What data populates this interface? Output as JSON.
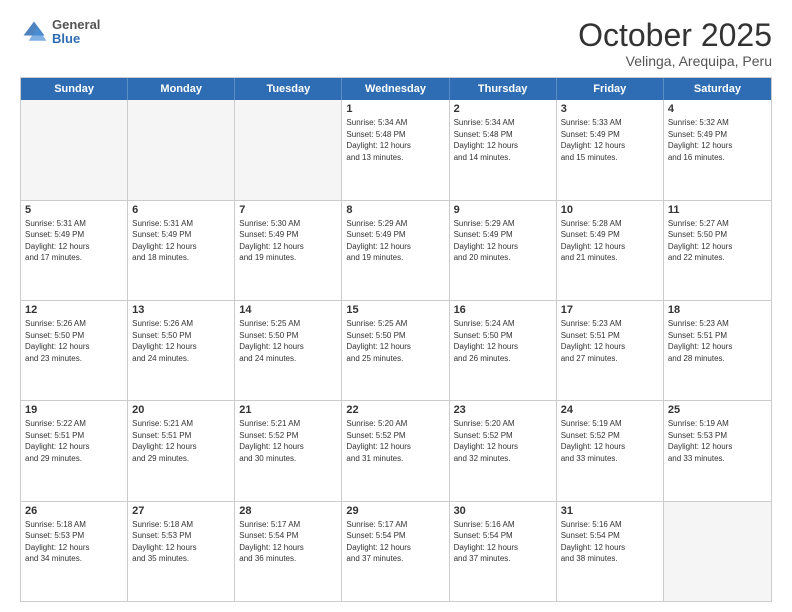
{
  "header": {
    "logo": {
      "general": "General",
      "blue": "Blue"
    },
    "title": "October 2025",
    "subtitle": "Velinga, Arequipa, Peru"
  },
  "days": [
    "Sunday",
    "Monday",
    "Tuesday",
    "Wednesday",
    "Thursday",
    "Friday",
    "Saturday"
  ],
  "weeks": [
    [
      {
        "day": "",
        "info": "",
        "empty": true
      },
      {
        "day": "",
        "info": "",
        "empty": true
      },
      {
        "day": "",
        "info": "",
        "empty": true
      },
      {
        "day": "1",
        "info": "Sunrise: 5:34 AM\nSunset: 5:48 PM\nDaylight: 12 hours\nand 13 minutes."
      },
      {
        "day": "2",
        "info": "Sunrise: 5:34 AM\nSunset: 5:48 PM\nDaylight: 12 hours\nand 14 minutes."
      },
      {
        "day": "3",
        "info": "Sunrise: 5:33 AM\nSunset: 5:49 PM\nDaylight: 12 hours\nand 15 minutes."
      },
      {
        "day": "4",
        "info": "Sunrise: 5:32 AM\nSunset: 5:49 PM\nDaylight: 12 hours\nand 16 minutes."
      }
    ],
    [
      {
        "day": "5",
        "info": "Sunrise: 5:31 AM\nSunset: 5:49 PM\nDaylight: 12 hours\nand 17 minutes."
      },
      {
        "day": "6",
        "info": "Sunrise: 5:31 AM\nSunset: 5:49 PM\nDaylight: 12 hours\nand 18 minutes."
      },
      {
        "day": "7",
        "info": "Sunrise: 5:30 AM\nSunset: 5:49 PM\nDaylight: 12 hours\nand 19 minutes."
      },
      {
        "day": "8",
        "info": "Sunrise: 5:29 AM\nSunset: 5:49 PM\nDaylight: 12 hours\nand 19 minutes."
      },
      {
        "day": "9",
        "info": "Sunrise: 5:29 AM\nSunset: 5:49 PM\nDaylight: 12 hours\nand 20 minutes."
      },
      {
        "day": "10",
        "info": "Sunrise: 5:28 AM\nSunset: 5:49 PM\nDaylight: 12 hours\nand 21 minutes."
      },
      {
        "day": "11",
        "info": "Sunrise: 5:27 AM\nSunset: 5:50 PM\nDaylight: 12 hours\nand 22 minutes."
      }
    ],
    [
      {
        "day": "12",
        "info": "Sunrise: 5:26 AM\nSunset: 5:50 PM\nDaylight: 12 hours\nand 23 minutes."
      },
      {
        "day": "13",
        "info": "Sunrise: 5:26 AM\nSunset: 5:50 PM\nDaylight: 12 hours\nand 24 minutes."
      },
      {
        "day": "14",
        "info": "Sunrise: 5:25 AM\nSunset: 5:50 PM\nDaylight: 12 hours\nand 24 minutes."
      },
      {
        "day": "15",
        "info": "Sunrise: 5:25 AM\nSunset: 5:50 PM\nDaylight: 12 hours\nand 25 minutes."
      },
      {
        "day": "16",
        "info": "Sunrise: 5:24 AM\nSunset: 5:50 PM\nDaylight: 12 hours\nand 26 minutes."
      },
      {
        "day": "17",
        "info": "Sunrise: 5:23 AM\nSunset: 5:51 PM\nDaylight: 12 hours\nand 27 minutes."
      },
      {
        "day": "18",
        "info": "Sunrise: 5:23 AM\nSunset: 5:51 PM\nDaylight: 12 hours\nand 28 minutes."
      }
    ],
    [
      {
        "day": "19",
        "info": "Sunrise: 5:22 AM\nSunset: 5:51 PM\nDaylight: 12 hours\nand 29 minutes."
      },
      {
        "day": "20",
        "info": "Sunrise: 5:21 AM\nSunset: 5:51 PM\nDaylight: 12 hours\nand 29 minutes."
      },
      {
        "day": "21",
        "info": "Sunrise: 5:21 AM\nSunset: 5:52 PM\nDaylight: 12 hours\nand 30 minutes."
      },
      {
        "day": "22",
        "info": "Sunrise: 5:20 AM\nSunset: 5:52 PM\nDaylight: 12 hours\nand 31 minutes."
      },
      {
        "day": "23",
        "info": "Sunrise: 5:20 AM\nSunset: 5:52 PM\nDaylight: 12 hours\nand 32 minutes."
      },
      {
        "day": "24",
        "info": "Sunrise: 5:19 AM\nSunset: 5:52 PM\nDaylight: 12 hours\nand 33 minutes."
      },
      {
        "day": "25",
        "info": "Sunrise: 5:19 AM\nSunset: 5:53 PM\nDaylight: 12 hours\nand 33 minutes."
      }
    ],
    [
      {
        "day": "26",
        "info": "Sunrise: 5:18 AM\nSunset: 5:53 PM\nDaylight: 12 hours\nand 34 minutes."
      },
      {
        "day": "27",
        "info": "Sunrise: 5:18 AM\nSunset: 5:53 PM\nDaylight: 12 hours\nand 35 minutes."
      },
      {
        "day": "28",
        "info": "Sunrise: 5:17 AM\nSunset: 5:54 PM\nDaylight: 12 hours\nand 36 minutes."
      },
      {
        "day": "29",
        "info": "Sunrise: 5:17 AM\nSunset: 5:54 PM\nDaylight: 12 hours\nand 37 minutes."
      },
      {
        "day": "30",
        "info": "Sunrise: 5:16 AM\nSunset: 5:54 PM\nDaylight: 12 hours\nand 37 minutes."
      },
      {
        "day": "31",
        "info": "Sunrise: 5:16 AM\nSunset: 5:54 PM\nDaylight: 12 hours\nand 38 minutes."
      },
      {
        "day": "",
        "info": "",
        "empty": true
      }
    ]
  ]
}
